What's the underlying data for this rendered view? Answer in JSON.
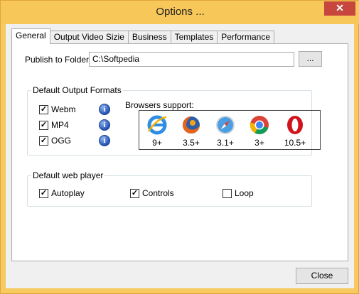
{
  "window": {
    "title": "Options ...",
    "close_glyph": "✕"
  },
  "tabs": [
    "General",
    "Output Video Sizie",
    "Business",
    "Templates",
    "Performance"
  ],
  "publish": {
    "label": "Publish to Folder:",
    "value": "C:\\Softpedia",
    "browse_label": "..."
  },
  "formats": {
    "group_title": "Default Output Formats",
    "items": [
      {
        "label": "Webm",
        "checked": true
      },
      {
        "label": "MP4",
        "checked": true
      },
      {
        "label": "OGG",
        "checked": true
      }
    ],
    "info_glyph": "i"
  },
  "browsers": {
    "title": "Browsers support:",
    "items": [
      {
        "icon": "internet-explorer-icon",
        "version": "9+"
      },
      {
        "icon": "firefox-icon",
        "version": "3.5+"
      },
      {
        "icon": "safari-icon",
        "version": "3.1+"
      },
      {
        "icon": "chrome-icon",
        "version": "3+"
      },
      {
        "icon": "opera-icon",
        "version": "10.5+"
      }
    ]
  },
  "player": {
    "group_title": "Default web player",
    "autoplay": {
      "label": "Autoplay",
      "checked": true
    },
    "controls": {
      "label": "Controls",
      "checked": true
    },
    "loop": {
      "label": "Loop",
      "checked": false
    }
  },
  "footer": {
    "close_label": "Close"
  },
  "colors": {
    "titlebar": "#f7c75a",
    "close_button": "#c7463d",
    "panel": "#ffffff",
    "client": "#f0f0f0"
  }
}
